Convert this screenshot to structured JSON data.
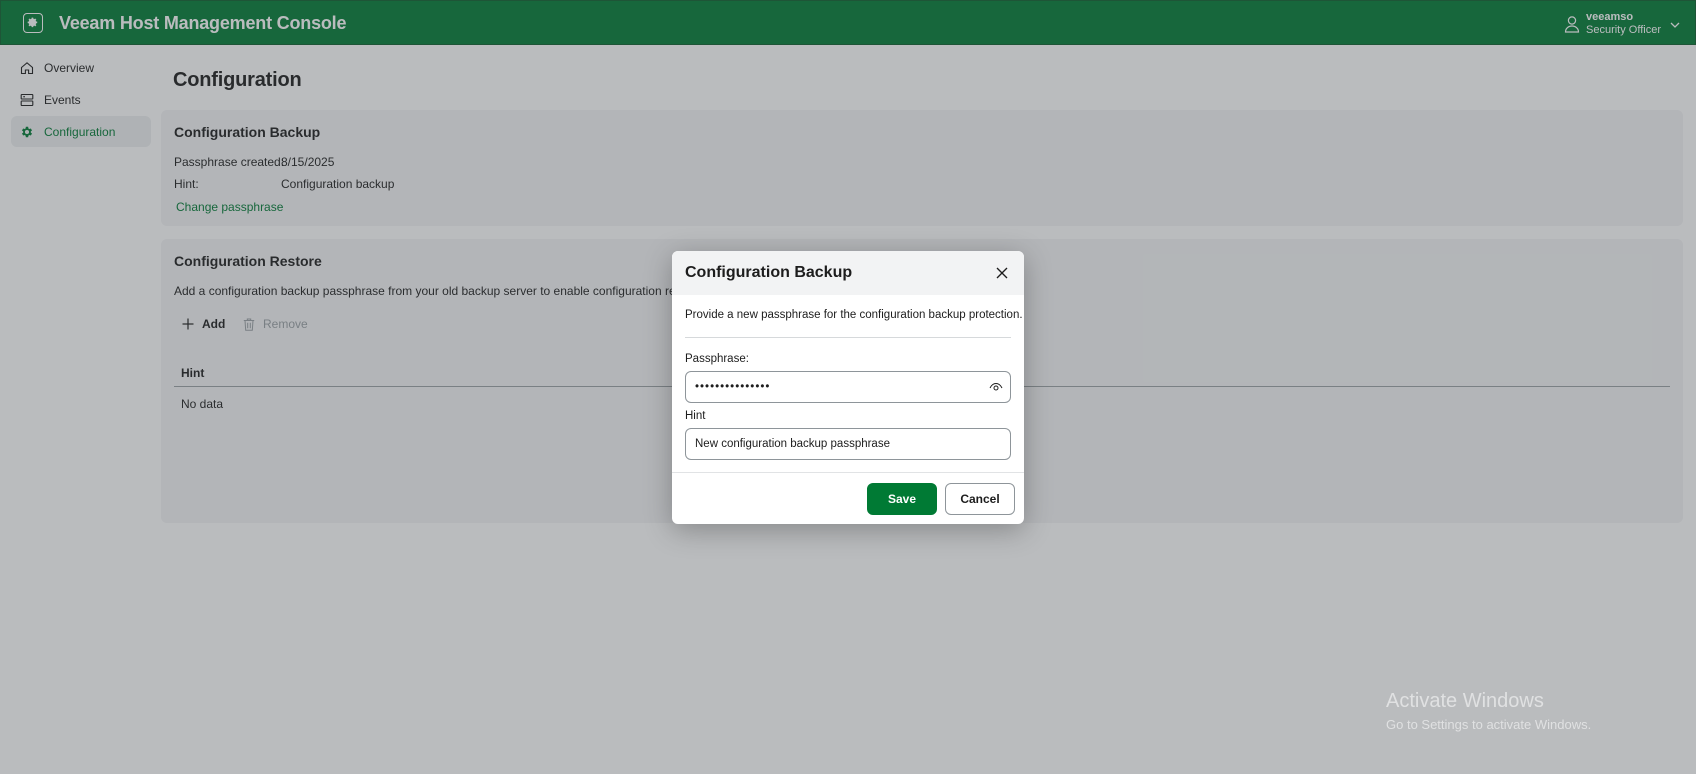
{
  "app": {
    "title": "Veeam Host Management Console",
    "logo_icon": "veeam-gear-logo-icon",
    "accent_color": "#007a34"
  },
  "user": {
    "name": "veeamso",
    "role": "Security Officer",
    "icon": "user-icon",
    "menu_icon": "chevron-down-icon"
  },
  "sidebar": {
    "items": [
      {
        "label": "Overview",
        "icon": "home-icon",
        "active": false
      },
      {
        "label": "Events",
        "icon": "events-icon",
        "active": false
      },
      {
        "label": "Configuration",
        "icon": "gear-icon",
        "active": true
      }
    ]
  },
  "page": {
    "title": "Configuration"
  },
  "backup_card": {
    "title": "Configuration Backup",
    "passphrase_created_label": "Passphrase created:",
    "passphrase_created_value": "8/15/2025",
    "hint_label": "Hint:",
    "hint_value": "Configuration backup",
    "change_link": "Change passphrase"
  },
  "restore_card": {
    "title": "Configuration Restore",
    "description": "Add a configuration backup passphrase from your old backup server to enable configuration restore.",
    "add_label": "Add",
    "add_icon": "plus-icon",
    "remove_label": "Remove",
    "remove_icon": "trash-icon",
    "table": {
      "columns": [
        "Hint"
      ],
      "empty_text": "No data"
    }
  },
  "modal": {
    "title": "Configuration Backup",
    "close_icon": "close-icon",
    "description": "Provide a new passphrase for the configuration backup protection.",
    "passphrase_label": "Passphrase:",
    "passphrase_value": "•••••••••••••••",
    "reveal_icon": "eye-icon",
    "hint_label": "Hint",
    "hint_value": "New configuration backup passphrase",
    "save_label": "Save",
    "cancel_label": "Cancel"
  },
  "watermark": {
    "title": "Activate Windows",
    "subtitle": "Go to Settings to activate Windows."
  }
}
